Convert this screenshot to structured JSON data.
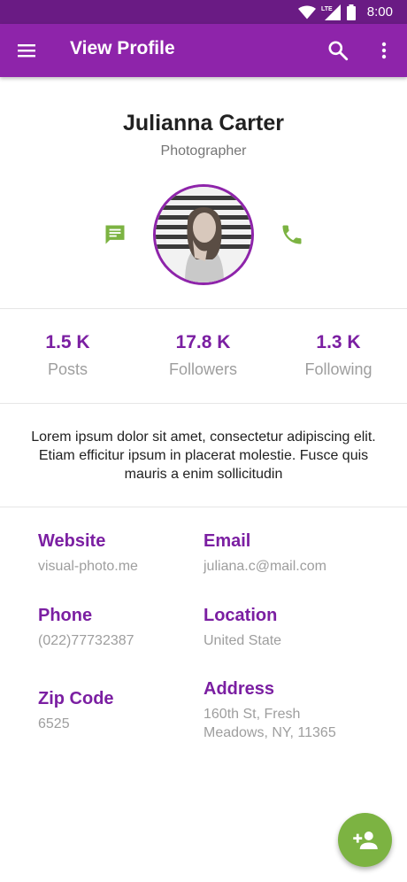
{
  "status_bar": {
    "time": "8:00",
    "network": "LTE",
    "icons": [
      "wifi-icon",
      "signal-icon",
      "battery-icon"
    ]
  },
  "app_bar": {
    "title": "View Profile",
    "color": "#8e24aa",
    "icons": [
      "menu-icon",
      "search-icon",
      "more-vert-icon"
    ]
  },
  "profile": {
    "name": "Julianna Carter",
    "role": "Photographer",
    "avatar_border_color": "#8e24aa",
    "action_icons": [
      "message-icon",
      "phone-icon"
    ],
    "action_color": "#7cb342"
  },
  "stats": [
    {
      "value": "1.5 K",
      "label": "Posts"
    },
    {
      "value": "17.8 K",
      "label": "Followers"
    },
    {
      "value": "1.3 K",
      "label": "Following"
    }
  ],
  "bio": "Lorem ipsum dolor sit amet, consectetur adipiscing elit. Etiam efficitur ipsum in placerat molestie.  Fusce quis mauris a enim sollicitudin",
  "details": {
    "website": {
      "label": "Website",
      "value": "visual-photo.me"
    },
    "email": {
      "label": "Email",
      "value": "juliana.c@mail.com"
    },
    "phone": {
      "label": "Phone",
      "value": "(022)77732387"
    },
    "location": {
      "label": "Location",
      "value": "United State"
    },
    "zip": {
      "label": "Zip Code",
      "value": "6525"
    },
    "address": {
      "label": "Address",
      "value_line1": "160th St, Fresh",
      "value_line2": "Meadows, NY, 11365"
    }
  },
  "fab": {
    "icon": "person-add-icon",
    "color": "#7cb342"
  }
}
